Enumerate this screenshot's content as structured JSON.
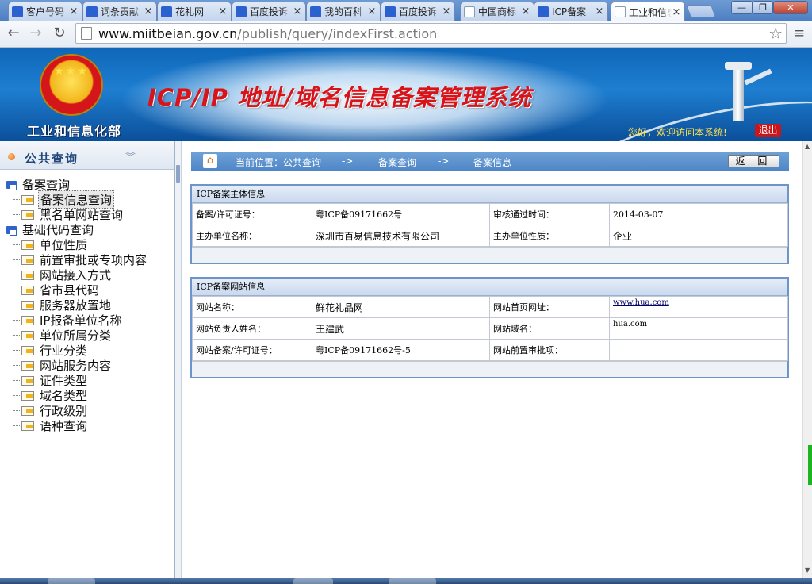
{
  "browser": {
    "tabs": [
      {
        "title": "客户号码",
        "icon": "paw-icon"
      },
      {
        "title": "词条贡献",
        "icon": "paw-icon"
      },
      {
        "title": "花礼网_",
        "icon": "paw-icon"
      },
      {
        "title": "百度投诉",
        "icon": "paw-icon"
      },
      {
        "title": "我的百科",
        "icon": "paw-icon"
      },
      {
        "title": "百度投诉",
        "icon": "paw-icon"
      },
      {
        "title": "中国商标",
        "icon": "page-icon"
      },
      {
        "title": "ICP备案",
        "icon": "paw-icon"
      },
      {
        "title": "工业和信息化部",
        "icon": "page-icon",
        "active": true
      }
    ],
    "url_host": "www.miitbeian.gov.cn",
    "url_path": "/publish/query/indexFirst.action"
  },
  "banner": {
    "ministry": "工业和信息化部",
    "system_title": "ICP/IP 地址/域名信息备案管理系统",
    "welcome": "您好，欢迎访问本系统!",
    "logout": "退出"
  },
  "sidebar": {
    "header": "公共查询",
    "groups": [
      {
        "label": "备案查询",
        "items": [
          "备案信息查询",
          "黑名单网站查询"
        ]
      },
      {
        "label": "基础代码查询",
        "items": [
          "单位性质",
          "前置审批或专项内容",
          "网站接入方式",
          "省市县代码",
          "服务器放置地",
          "IP报备单位名称",
          "单位所属分类",
          "行业分类",
          "网站服务内容",
          "证件类型",
          "域名类型",
          "行政级别",
          "语种查询"
        ]
      }
    ],
    "selected": "备案信息查询"
  },
  "breadcrumb": {
    "location": "当前位置：公共查询",
    "arrow": "->",
    "page1": "备案查询",
    "page2": "备案信息"
  },
  "return_button": "返 回",
  "subject_panel": {
    "title": "ICP备案主体信息",
    "license_label": "备案/许可证号：",
    "license_value": "粤ICP备09171662号",
    "approval_time_label": "审核通过时间：",
    "approval_time_value": "2014-03-07",
    "org_name_label": "主办单位名称：",
    "org_name_value": "深圳市百易信息技术有限公司",
    "org_type_label": "主办单位性质：",
    "org_type_value": "企业"
  },
  "website_panel": {
    "title": "ICP备案网站信息",
    "site_name_label": "网站名称：",
    "site_name_value": "鲜花礼品网",
    "home_url_label": "网站首页网址：",
    "home_url_value": "www.hua.com",
    "owner_label": "网站负责人姓名：",
    "owner_value": "王建武",
    "domain_label": "网站域名：",
    "domain_value": "hua.com",
    "site_license_label": "网站备案/许可证号：",
    "site_license_value": "粤ICP备09171662号-5",
    "preapproval_label": "网站前置审批项：",
    "preapproval_value": ""
  },
  "colors": {
    "banner_blue": "#1e7ed0",
    "title_red": "#d8141a",
    "welcome_yellow": "#ffe14a",
    "crumb_blue": "#5b90cc"
  }
}
